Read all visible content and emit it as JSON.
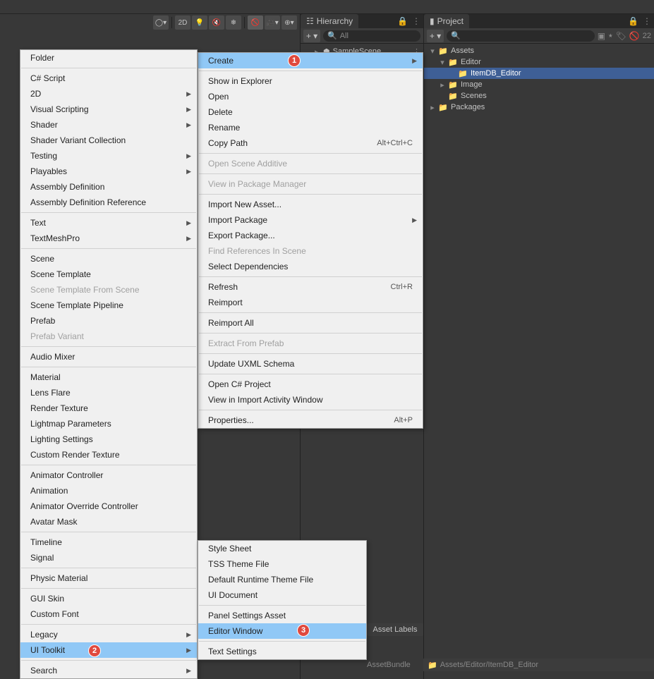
{
  "toolbar": {
    "btn_2d": "2D"
  },
  "hierarchy": {
    "tab": "Hierarchy",
    "search_placeholder": "All",
    "scene": "SampleScene"
  },
  "project": {
    "tab": "Project",
    "hidden_count": "22",
    "tree": {
      "assets": "Assets",
      "editor": "Editor",
      "itemdb": "ItemDB_Editor",
      "image": "Image",
      "scenes": "Scenes",
      "packages": "Packages"
    },
    "pathbar": "Assets/Editor/ItemDB_Editor"
  },
  "inspector": {
    "asset_labels": "Asset Labels",
    "assetbundle": "AssetBundle"
  },
  "context_menu": {
    "create": "Create",
    "show_in_explorer": "Show in Explorer",
    "open": "Open",
    "delete": "Delete",
    "rename": "Rename",
    "copy_path": "Copy Path",
    "copy_path_sc": "Alt+Ctrl+C",
    "open_scene_additive": "Open Scene Additive",
    "view_in_pkg": "View in Package Manager",
    "import_new": "Import New Asset...",
    "import_pkg": "Import Package",
    "export_pkg": "Export Package...",
    "find_refs": "Find References In Scene",
    "select_deps": "Select Dependencies",
    "refresh": "Refresh",
    "refresh_sc": "Ctrl+R",
    "reimport": "Reimport",
    "reimport_all": "Reimport All",
    "extract_prefab": "Extract From Prefab",
    "update_uxml": "Update UXML Schema",
    "open_cs": "Open C# Project",
    "view_import": "View in Import Activity Window",
    "properties": "Properties...",
    "properties_sc": "Alt+P"
  },
  "create_menu": {
    "folder": "Folder",
    "cs_script": "C# Script",
    "_2d": "2D",
    "visual_scripting": "Visual Scripting",
    "shader": "Shader",
    "shader_variant": "Shader Variant Collection",
    "testing": "Testing",
    "playables": "Playables",
    "assembly_def": "Assembly Definition",
    "assembly_def_ref": "Assembly Definition Reference",
    "text": "Text",
    "textmeshpro": "TextMeshPro",
    "scene": "Scene",
    "scene_template": "Scene Template",
    "scene_template_from": "Scene Template From Scene",
    "scene_template_pipeline": "Scene Template Pipeline",
    "prefab": "Prefab",
    "prefab_variant": "Prefab Variant",
    "audio_mixer": "Audio Mixer",
    "material": "Material",
    "lens_flare": "Lens Flare",
    "render_texture": "Render Texture",
    "lightmap_params": "Lightmap Parameters",
    "lighting_settings": "Lighting Settings",
    "custom_render_texture": "Custom Render Texture",
    "animator_controller": "Animator Controller",
    "animation": "Animation",
    "animator_override": "Animator Override Controller",
    "avatar_mask": "Avatar Mask",
    "timeline": "Timeline",
    "signal": "Signal",
    "physic_material": "Physic Material",
    "gui_skin": "GUI Skin",
    "custom_font": "Custom Font",
    "legacy": "Legacy",
    "ui_toolkit": "UI Toolkit",
    "search": "Search"
  },
  "uitoolkit_menu": {
    "style_sheet": "Style Sheet",
    "tss_theme": "TSS Theme File",
    "default_runtime": "Default Runtime Theme File",
    "ui_document": "UI Document",
    "panel_settings": "Panel Settings Asset",
    "editor_window": "Editor Window",
    "text_settings": "Text Settings"
  },
  "badges": {
    "b1": "1",
    "b2": "2",
    "b3": "3"
  }
}
